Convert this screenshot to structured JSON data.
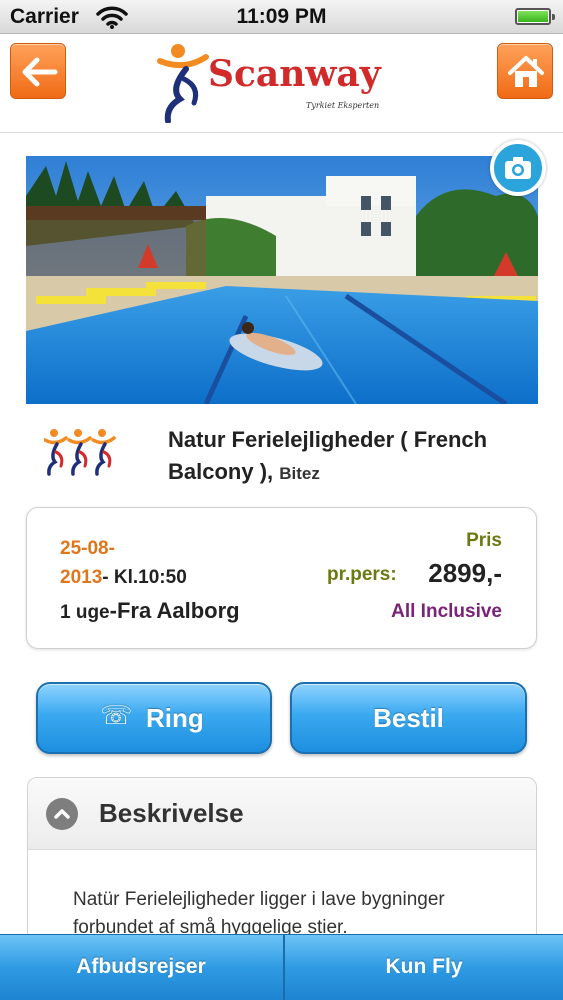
{
  "status_bar": {
    "carrier": "Carrier",
    "time": "11:09 PM",
    "battery_level": 1.0
  },
  "header": {
    "logo_text": "Scanway",
    "logo_subtitle": "Tyrkiet Eksperten",
    "back_icon": "arrow-left-icon",
    "home_icon": "home-icon"
  },
  "hotel": {
    "name": "Natur Ferielejligheder ( French Balcony )",
    "separator": ", ",
    "city": "Bitez",
    "rating": 3
  },
  "trip": {
    "date": "25-08-2013",
    "date_line1": "25-08-",
    "date_line2": "2013",
    "time": "- Kl.10:50",
    "duration": "1 uge",
    "from": "-Fra Aalborg",
    "price_label": "Pris",
    "per_person_label": "pr.pers:",
    "price": "2899,-",
    "board": "All Inclusive"
  },
  "buttons": {
    "ring": "Ring",
    "ring_icon": "phone-icon",
    "bestil": "Bestil"
  },
  "description": {
    "title": "Beskrivelse",
    "text": "Natür Ferielejligheder ligger i lave bygninger forbundet af små hyggelige stier."
  },
  "tabs": [
    {
      "label": "Afbudsrejser"
    },
    {
      "label": "Kun Fly"
    }
  ],
  "colors": {
    "accent_orange": "#f06a15",
    "button_blue": "#2f9be3",
    "date_orange": "#e0761c",
    "price_green": "#6a7a12",
    "board_purple": "#7a2378",
    "logo_red": "#d02a2a"
  }
}
